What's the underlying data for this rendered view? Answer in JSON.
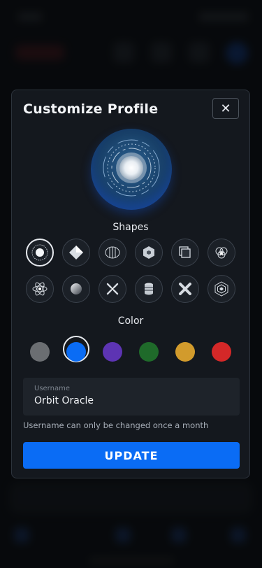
{
  "modal": {
    "title": "Customize Profile",
    "close_label": "✕"
  },
  "shapes": {
    "label": "Shapes",
    "items": [
      {
        "icon": "radial-burst-icon",
        "selected": true
      },
      {
        "icon": "diamond-icon",
        "selected": false
      },
      {
        "icon": "striped-sphere-icon",
        "selected": false
      },
      {
        "icon": "hexagon-cube-icon",
        "selected": false
      },
      {
        "icon": "stacked-squares-icon",
        "selected": false
      },
      {
        "icon": "star-cluster-icon",
        "selected": false
      },
      {
        "icon": "atom-icon",
        "selected": false
      },
      {
        "icon": "gradient-orb-icon",
        "selected": false
      },
      {
        "icon": "cross-arrows-icon",
        "selected": false
      },
      {
        "icon": "database-stack-icon",
        "selected": false
      },
      {
        "icon": "x-cross-icon",
        "selected": false
      },
      {
        "icon": "nested-hexagon-icon",
        "selected": false
      }
    ]
  },
  "color": {
    "label": "Color",
    "swatches": [
      {
        "name": "gray",
        "hex": "#6b6e72",
        "selected": false
      },
      {
        "name": "blue",
        "hex": "#0a6cf5",
        "selected": true
      },
      {
        "name": "purple",
        "hex": "#5d34b3",
        "selected": false
      },
      {
        "name": "green",
        "hex": "#1f6a2a",
        "selected": false
      },
      {
        "name": "gold",
        "hex": "#d29b2c",
        "selected": false
      },
      {
        "name": "red",
        "hex": "#d42828",
        "selected": false
      }
    ]
  },
  "username": {
    "label": "Username",
    "value": "Orbit Oracle",
    "hint": "Username can only be changed once a month"
  },
  "update_label": "UPDATE"
}
